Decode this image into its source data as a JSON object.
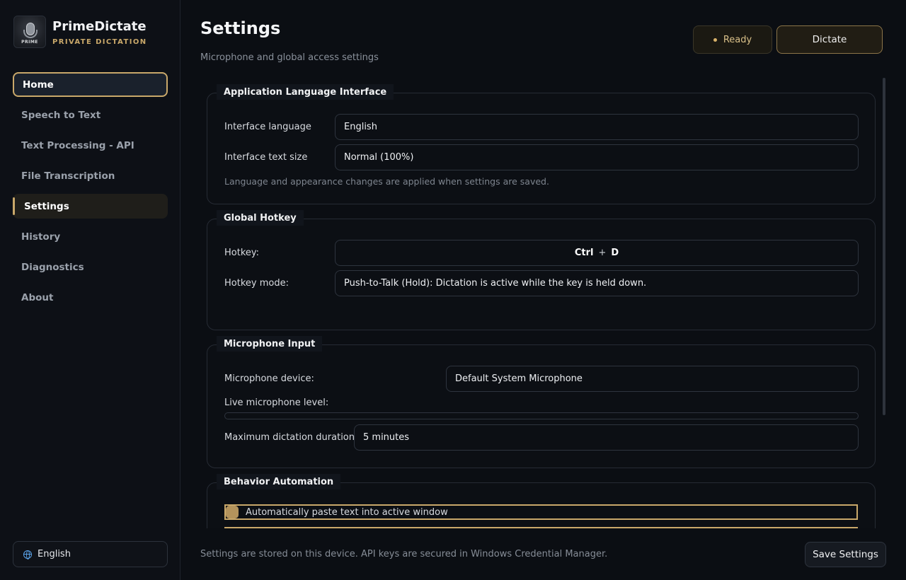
{
  "brand": {
    "name": "PrimeDictate",
    "subtitle": "PRIVATE DICTATION",
    "logo_text": "PRIME"
  },
  "sidebar": {
    "items": [
      {
        "label": "Home"
      },
      {
        "label": "Speech to Text"
      },
      {
        "label": "Text Processing - API"
      },
      {
        "label": "File Transcription"
      },
      {
        "label": "Settings"
      },
      {
        "label": "History"
      },
      {
        "label": "Diagnostics"
      },
      {
        "label": "About"
      }
    ],
    "language_button": "English"
  },
  "header": {
    "title": "Settings",
    "subtitle": "Microphone and global access settings",
    "status_label": "Ready",
    "dictate_label": "Dictate"
  },
  "sections": {
    "language": {
      "title": "Application Language  Interface",
      "interface_language_label": "Interface language",
      "interface_language_value": "English",
      "text_size_label": "Interface text size",
      "text_size_value": "Normal (100%)",
      "hint": "Language and appearance changes are applied when settings are saved."
    },
    "hotkey": {
      "title": "Global Hotkey",
      "hotkey_label": "Hotkey:",
      "hotkey_key1": "Ctrl",
      "hotkey_plus": "+",
      "hotkey_key2": "D",
      "mode_label": "Hotkey mode:",
      "mode_value": "Push-to-Talk (Hold): Dictation is active while the key is held down."
    },
    "microphone": {
      "title": "Microphone Input",
      "device_label": "Microphone device:",
      "device_value": "Default System Microphone",
      "level_label": "Live microphone level:",
      "level_value": 0,
      "duration_label": "Maximum dictation duration:",
      "duration_value": "5 minutes"
    },
    "behavior": {
      "title": "Behavior  Automation",
      "auto_paste_label": "Automatically paste text into active window"
    }
  },
  "footer": {
    "note": "Settings are stored on this device. API keys are secured in Windows Credential Manager.",
    "save_label": "Save Settings"
  },
  "colors": {
    "accent": "#c9a86a",
    "background": "#0b0e13",
    "globe": "#5aa2e8"
  },
  "icons": {
    "logo": "microphone-logo-icon",
    "language": "globe-icon",
    "status": "status-dot-icon"
  }
}
